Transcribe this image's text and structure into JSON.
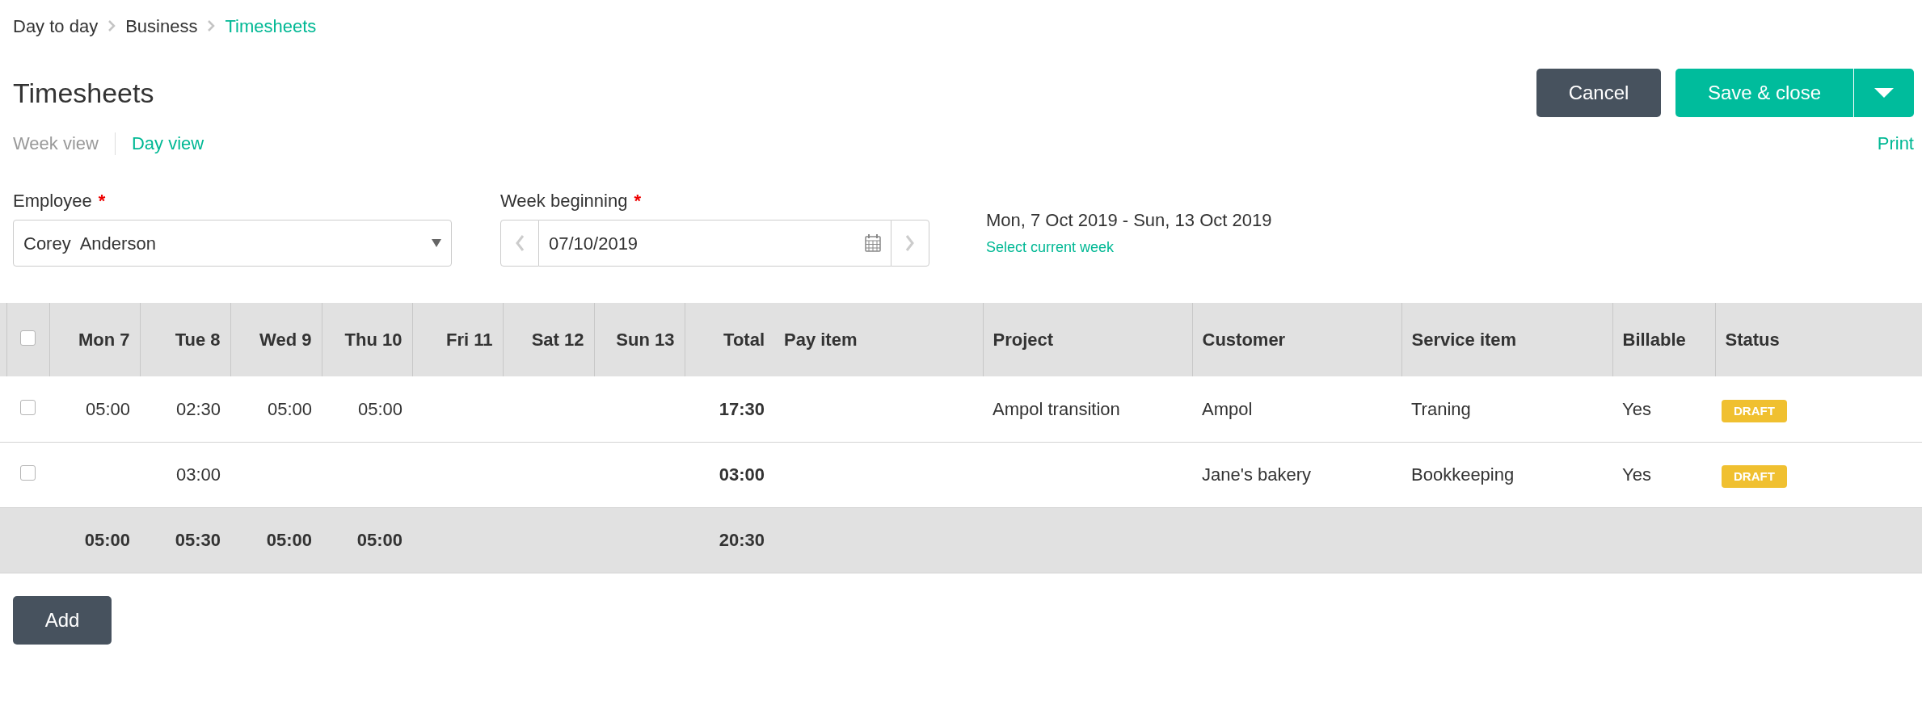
{
  "breadcrumb": [
    {
      "label": "Day to day",
      "current": false
    },
    {
      "label": "Business",
      "current": false
    },
    {
      "label": "Timesheets",
      "current": true
    }
  ],
  "title": "Timesheets",
  "actions": {
    "cancel": "Cancel",
    "save": "Save & close"
  },
  "tabs": [
    {
      "label": "Week view",
      "selected": false
    },
    {
      "label": "Day view",
      "selected": true
    }
  ],
  "print": "Print",
  "employee": {
    "label": "Employee",
    "required_mark": "*",
    "value": "Corey  Anderson"
  },
  "week_beginning": {
    "label": "Week beginning",
    "required_mark": "*",
    "value": "07/10/2019"
  },
  "week_range": "Mon, 7 Oct 2019 - Sun, 13 Oct 2019",
  "select_current_week": "Select current week",
  "table": {
    "select_all_checked": false,
    "columns": [
      {
        "label": "Mon 7",
        "kind": "time"
      },
      {
        "label": "Tue 8",
        "kind": "time"
      },
      {
        "label": "Wed 9",
        "kind": "time"
      },
      {
        "label": "Thu 10",
        "kind": "time"
      },
      {
        "label": "Fri 11",
        "kind": "time"
      },
      {
        "label": "Sat 12",
        "kind": "time"
      },
      {
        "label": "Sun 13",
        "kind": "time"
      },
      {
        "label": "Total",
        "kind": "total"
      },
      {
        "label": "Pay item",
        "kind": "text"
      },
      {
        "label": "Project",
        "kind": "text"
      },
      {
        "label": "Customer",
        "kind": "text"
      },
      {
        "label": "Service item",
        "kind": "text"
      },
      {
        "label": "Billable",
        "kind": "text"
      },
      {
        "label": "Status",
        "kind": "text"
      }
    ],
    "rows": [
      {
        "checked": false,
        "cells": [
          "05:00",
          "02:30",
          "05:00",
          "05:00",
          null,
          null,
          null,
          "17:30",
          null,
          "Ampol transition",
          "Ampol",
          "Traning",
          "Yes"
        ],
        "status": "DRAFT"
      },
      {
        "checked": false,
        "cells": [
          null,
          "03:00",
          null,
          null,
          null,
          null,
          null,
          "03:00",
          null,
          null,
          "Jane's bakery",
          "Bookkeeping",
          "Yes"
        ],
        "status": "DRAFT"
      }
    ],
    "totals": {
      "cells": [
        "05:00",
        "05:30",
        "05:00",
        "05:00",
        null,
        null,
        null,
        "20:30"
      ]
    }
  },
  "add": "Add"
}
